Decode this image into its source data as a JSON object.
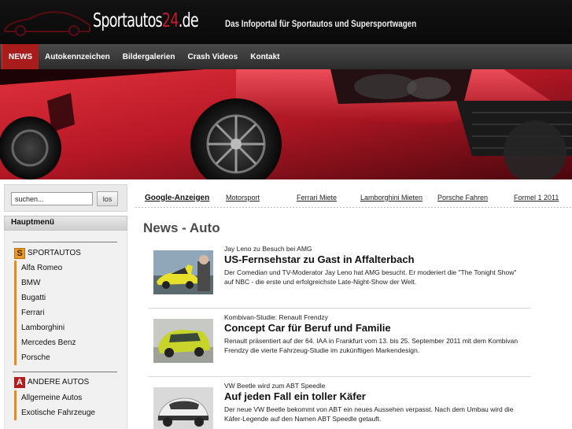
{
  "site": {
    "logo_main": "Sportautos",
    "logo_num": "24",
    "logo_tld": ".de",
    "tagline": "Das Infoportal für Sportautos und Supersportwagen"
  },
  "nav": {
    "items": [
      {
        "label": "NEWS",
        "active": true
      },
      {
        "label": "Autokennzeichen"
      },
      {
        "label": "Bildergalerien"
      },
      {
        "label": "Crash Videos"
      },
      {
        "label": "Kontakt"
      }
    ]
  },
  "search": {
    "value": "suchen...",
    "button_label": "los"
  },
  "sidebar": {
    "menu_title": "Hauptmenü",
    "categories": [
      {
        "icon": "S",
        "title": "SPORTAUTOS",
        "items": [
          "Alfa Romeo",
          "BMW",
          "Bugatti",
          "Ferrari",
          "Lamborghini",
          "Mercedes Benz",
          "Porsche"
        ]
      },
      {
        "icon": "A",
        "title": "ANDERE AUTOS",
        "items": [
          "Allgemeine Autos",
          "Exotische Fahrzeuge"
        ]
      }
    ]
  },
  "ads": {
    "label": "Google-Anzeigen",
    "links": [
      "Motorsport",
      "Ferrari Miete",
      "Lamborghini Mieten",
      "Porsche Fahren",
      "Formel 1 2011"
    ]
  },
  "main": {
    "title": "News - Auto",
    "articles": [
      {
        "kicker": "Jay Leno zu Besuch bei AMG",
        "headline": "US-Fernsehstar zu Gast in Affalterbach",
        "teaser": "Der Comedian und TV-Moderator Jay Leno hat AMG besucht. Er moderiert die \"The Tonight Show\" auf NBC - die erste und erfolgreichste Late-Night-Show der Welt."
      },
      {
        "kicker": "Kombivan-Studie: Renault Frendzy",
        "headline": "Concept Car für Beruf und Familie",
        "teaser": "Renault präsentiert auf der 64. IAA in Frankfurt vom 13. bis 25. September 2011 mit dem Kombivan Frendzy die vierte Fahrzeug-Studie im zukünftigen Markendesign."
      },
      {
        "kicker": "VW Beetle wird zum ABT Speedle",
        "headline": "Auf jeden Fall ein toller Käfer",
        "teaser": "Der neue VW Beetle bekommt von ABT ein neues Aussehen verpasst. Nach dem Umbau wird die Käfer-Legende auf den Namen ABT Speedle getauft."
      }
    ]
  },
  "colors": {
    "accent_red": "#a81c1c",
    "nav_bg": "#3a3a3a",
    "header_bg": "#0e0e0e",
    "sidebar_bar": "#e88a1c"
  }
}
